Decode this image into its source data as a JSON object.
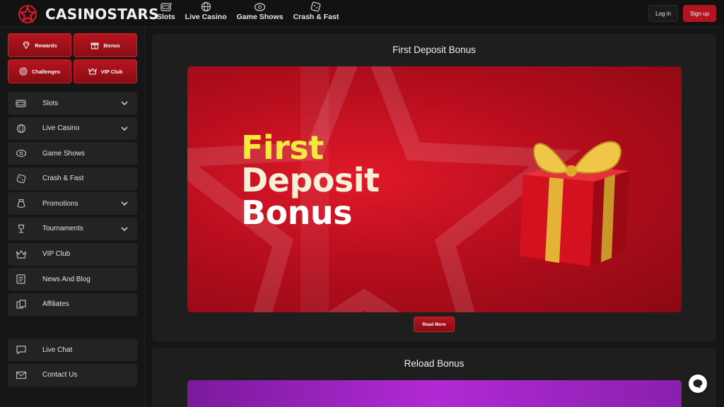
{
  "brand": {
    "name": "CASINOSTARS",
    "accent": "#b3141f"
  },
  "topnav": [
    {
      "label": "Slots",
      "icon": "slots-icon"
    },
    {
      "label": "Live Casino",
      "icon": "globe-icon"
    },
    {
      "label": "Game Shows",
      "icon": "game-shows-icon"
    },
    {
      "label": "Crash & Fast",
      "icon": "dice-icon"
    }
  ],
  "auth": {
    "login": "Log in",
    "signup": "Sign up"
  },
  "promo_buttons": [
    {
      "label": "Rewards",
      "icon": "diamond-icon"
    },
    {
      "label": "Bonus",
      "icon": "gift-icon"
    },
    {
      "label": "Challenges",
      "icon": "target-icon"
    },
    {
      "label": "VIP Club",
      "icon": "crown-icon"
    }
  ],
  "sidebar": {
    "items": [
      {
        "label": "Slots",
        "icon": "slots-icon",
        "expandable": true
      },
      {
        "label": "Live Casino",
        "icon": "globe-icon",
        "expandable": true
      },
      {
        "label": "Game Shows",
        "icon": "game-shows-icon",
        "expandable": false
      },
      {
        "label": "Crash & Fast",
        "icon": "dice-icon",
        "expandable": false
      },
      {
        "label": "Promotions",
        "icon": "money-bag-icon",
        "expandable": true
      },
      {
        "label": "Tournaments",
        "icon": "trophy-icon",
        "expandable": true
      },
      {
        "label": "VIP Club",
        "icon": "crown-icon",
        "expandable": false
      },
      {
        "label": "News And Blog",
        "icon": "news-icon",
        "expandable": false
      },
      {
        "label": "Affiliates",
        "icon": "affiliates-icon",
        "expandable": false
      }
    ],
    "bottom_items": [
      {
        "label": "Live Chat",
        "icon": "chat-icon"
      },
      {
        "label": "Contact Us",
        "icon": "mail-icon"
      }
    ]
  },
  "main": {
    "sections": [
      {
        "title": "First Deposit Bonus",
        "banner_lines": [
          "First",
          "Deposit",
          "Bonus"
        ],
        "button": "Read More"
      },
      {
        "title": "Reload Bonus"
      }
    ]
  }
}
